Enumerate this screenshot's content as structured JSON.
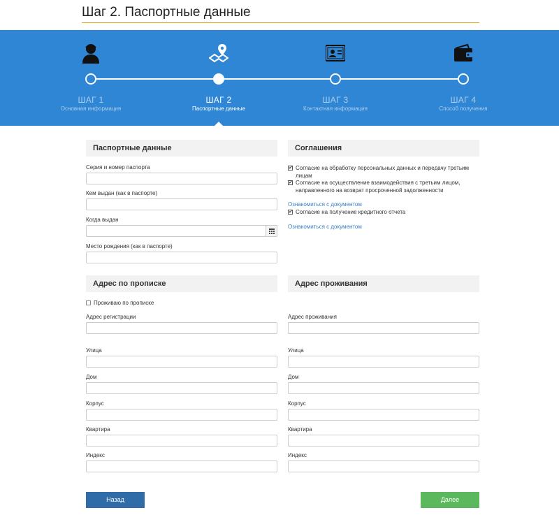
{
  "page": {
    "title": "Шаг 2. Паспортные данные"
  },
  "stepper": {
    "steps": [
      {
        "num": "ШАГ 1",
        "label": "Основная информация",
        "icon": "user-icon",
        "active": false
      },
      {
        "num": "ШАГ 2",
        "label": "Паспортные данные",
        "icon": "map-pin-icon",
        "active": true
      },
      {
        "num": "ШАГ 3",
        "label": "Контактная информация",
        "icon": "id-card-icon",
        "active": false
      },
      {
        "num": "ШАГ 4",
        "label": "Способ получения",
        "icon": "wallet-icon",
        "active": false
      }
    ]
  },
  "passport": {
    "heading": "Паспортные данные",
    "series_label": "Серия и номер паспорта",
    "issued_by_label": "Кем выдан (как в паспорте)",
    "issue_date_label": "Когда выдан",
    "birthplace_label": "Место рождения (как в паспорте)"
  },
  "agreements": {
    "heading": "Соглашения",
    "consent_personal": "Согласие на обработку персональных данных и передачу третьим лицам",
    "consent_interaction": "Согласие на осуществление взаимодействия с третьим лицом, направленного на возврат просроченной задолженности",
    "link_1": "Ознакомиться с документом",
    "consent_credit": "Согласие на получение кредитного отчета",
    "link_2": "Ознакомиться с документом"
  },
  "registration": {
    "heading": "Адрес по прописке",
    "same_checkbox": "Проживаю по прописке",
    "address_label": "Адрес регистрации",
    "street_label": "Улица",
    "house_label": "Дом",
    "building_label": "Корпус",
    "apartment_label": "Квартира",
    "index_label": "Индекс"
  },
  "residence": {
    "heading": "Адрес проживания",
    "address_label": "Адрес проживания",
    "street_label": "Улица",
    "house_label": "Дом",
    "building_label": "Корпус",
    "apartment_label": "Квартира",
    "index_label": "Индекс"
  },
  "actions": {
    "back": "Назад",
    "next": "Далее"
  },
  "colors": {
    "accent": "#2f86d4",
    "underline": "#e6a914",
    "back": "#2f6ca8",
    "next": "#5cb85c",
    "link": "#3a7fc1"
  }
}
